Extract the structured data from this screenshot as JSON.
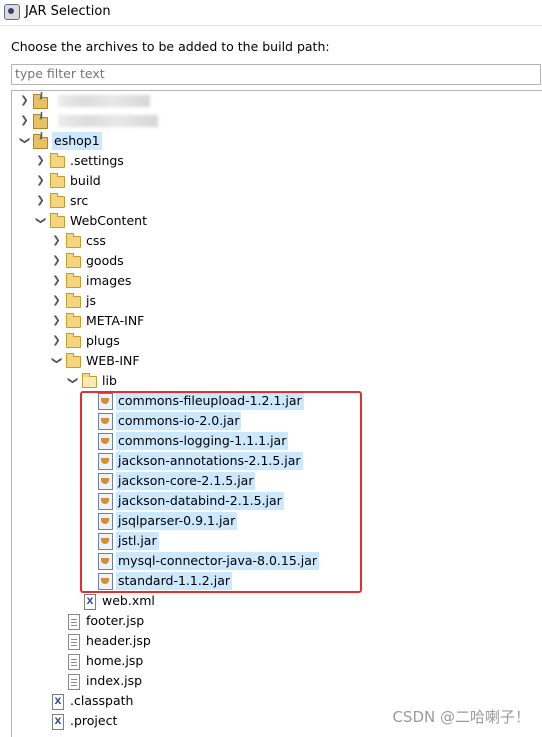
{
  "window": {
    "title": "JAR Selection"
  },
  "dialog": {
    "prompt": "Choose the archives to be added to the build path:",
    "filter_placeholder": "type filter text"
  },
  "tree": {
    "projects": [
      {
        "label": "",
        "obscured": true
      },
      {
        "label": "",
        "obscured": true
      },
      {
        "label": "eshop1",
        "expanded": true,
        "selected": true
      }
    ],
    "folders": {
      "settings": ".settings",
      "build": "build",
      "src": "src",
      "webcontent": "WebContent",
      "css": "css",
      "goods": "goods",
      "images": "images",
      "js": "js",
      "meta_inf": "META-INF",
      "plugs": "plugs",
      "web_inf": "WEB-INF",
      "lib": "lib"
    },
    "jars": [
      "commons-fileupload-1.2.1.jar",
      "commons-io-2.0.jar",
      "commons-logging-1.1.1.jar",
      "jackson-annotations-2.1.5.jar",
      "jackson-core-2.1.5.jar",
      "jackson-databind-2.1.5.jar",
      "jsqlparser-0.9.1.jar",
      "jstl.jar",
      "mysql-connector-java-8.0.15.jar",
      "standard-1.1.2.jar"
    ],
    "files": {
      "web_xml": "web.xml",
      "footer": "footer.jsp",
      "header": "header.jsp",
      "home": "home.jsp",
      "index": "index.jsp",
      "classpath": ".classpath",
      "project": ".project"
    }
  },
  "watermark": "CSDN @二哈喇子！",
  "colors": {
    "selection": "#cce8ff",
    "highlight_box": "#e23030"
  }
}
